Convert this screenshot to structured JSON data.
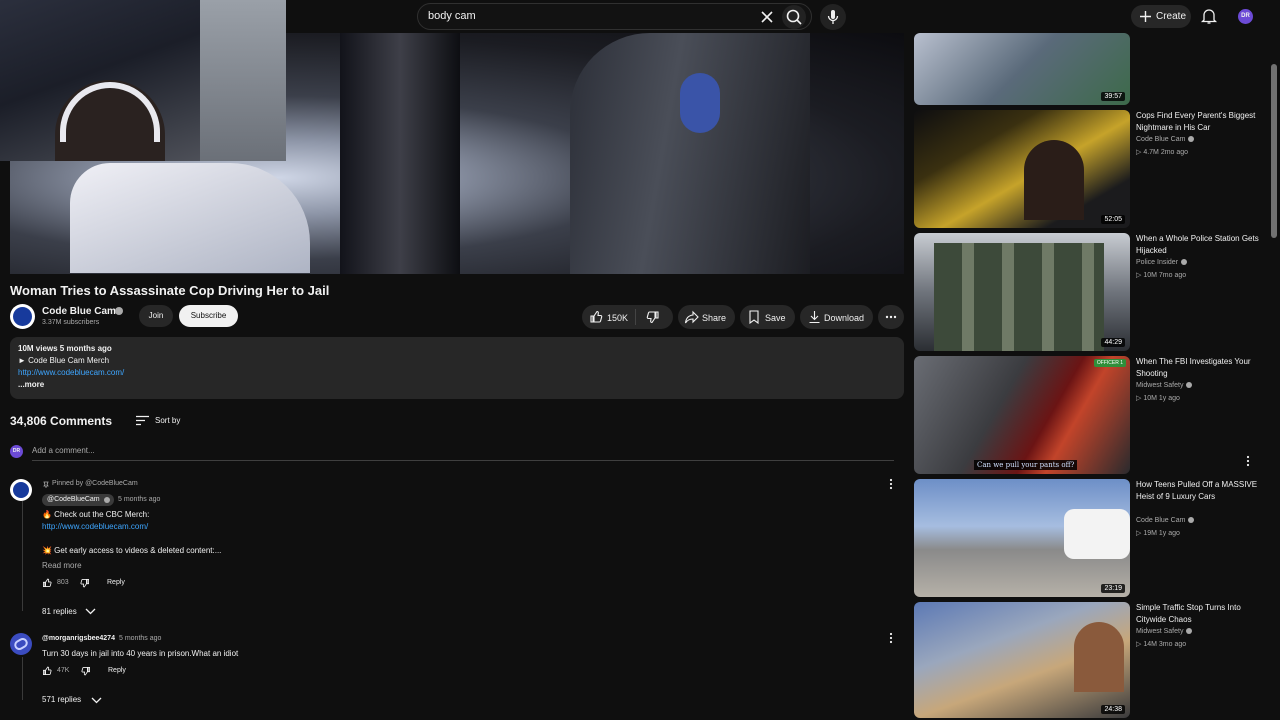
{
  "search": {
    "query": "body cam"
  },
  "header": {
    "create_label": "Create",
    "avatar_initials": "DR"
  },
  "video": {
    "title": "Woman Tries to Assassinate Cop Driving Her to Jail",
    "channel": "Code Blue Cam",
    "subscribers": "3.37M subscribers",
    "join_label": "Join",
    "subscribe_label": "Subscribe",
    "likes": "150K",
    "share_label": "Share",
    "save_label": "Save",
    "download_label": "Download"
  },
  "description": {
    "stats": "10M views  5 months ago",
    "line1": "► Code Blue Cam Merch",
    "link": "http://www.codebluecam.com/",
    "more": "...more"
  },
  "comments": {
    "count": "34,806 Comments",
    "sort_label": "Sort by",
    "add_placeholder": "Add a comment...",
    "items": [
      {
        "pinned": "Pinned by @CodeBlueCam",
        "author": "@CodeBlueCam",
        "time": "5 months ago",
        "line1": "🔥 Check out the CBC Merch:",
        "link": "http://www.codebluecam.com/",
        "line2": "💥 Get early access to videos & deleted content:...",
        "read_more": "Read more",
        "likes": "803",
        "reply_label": "Reply",
        "replies": "81 replies"
      },
      {
        "author": "@morganrigsbee4274",
        "time": "5 months ago",
        "text": "Turn 30 days in jail into 40 years in prison.What an idiot",
        "likes": "47K",
        "reply_label": "Reply",
        "replies": "571 replies"
      }
    ]
  },
  "sidebar": {
    "items": [
      {
        "duration": "39:57"
      },
      {
        "title": "Cops Find Every Parent's Biggest Nightmare in His Car",
        "channel": "Code Blue Cam",
        "meta": "4.7M  2mo ago",
        "duration": "52:05"
      },
      {
        "title": "When a Whole Police Station Gets Hijacked",
        "channel": "Police Insider",
        "meta": "10M  7mo ago",
        "duration": "44:29"
      },
      {
        "title": "When The FBI Investigates Your Shooting",
        "channel": "Midwest Safety",
        "meta": "10M  1y ago",
        "caption": "Can we pull your pants off?",
        "badge": "OFFICER 1"
      },
      {
        "title": "How Teens Pulled Off a MASSIVE Heist of 9 Luxury Cars",
        "channel": "Code Blue Cam",
        "meta": "19M  1y ago",
        "duration": "23:19"
      },
      {
        "title": "Simple Traffic Stop Turns Into Citywide Chaos",
        "channel": "Midwest Safety",
        "meta": "14M  3mo ago",
        "duration": "24:38"
      }
    ]
  }
}
